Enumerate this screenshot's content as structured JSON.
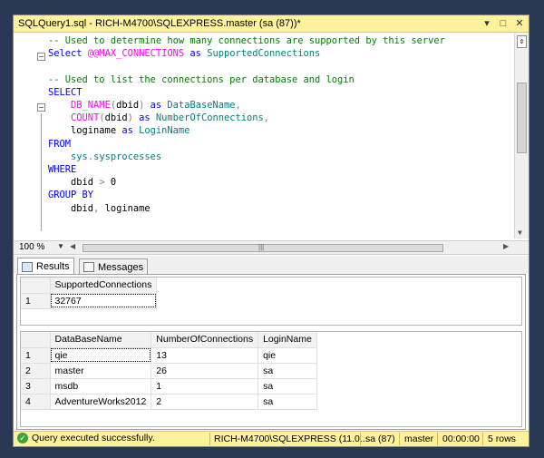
{
  "window": {
    "title": "SQLQuery1.sql - RICH-M4700\\SQLEXPRESS.master (sa (87))*",
    "controls": [
      "▾",
      "□",
      "✕"
    ]
  },
  "editor": {
    "lines": [
      {
        "parts": [
          {
            "t": "-- Used to determine how many connections are supported by this server",
            "c": "cm"
          }
        ]
      },
      {
        "parts": [
          {
            "t": "Select ",
            "c": "kw"
          },
          {
            "t": "@@MAX_CONNECTIONS",
            "c": "fn"
          },
          {
            "t": " as ",
            "c": "kw"
          },
          {
            "t": "SupportedConnections",
            "c": "tx"
          }
        ]
      },
      {
        "parts": []
      },
      {
        "parts": [
          {
            "t": "-- Used to list the connections per database and login",
            "c": "cm"
          }
        ]
      },
      {
        "parts": [
          {
            "t": "SELECT",
            "c": "kw"
          }
        ]
      },
      {
        "parts": [
          {
            "t": "    ",
            "c": "id"
          },
          {
            "t": "DB_NAME",
            "c": "fn"
          },
          {
            "t": "(",
            "c": "op"
          },
          {
            "t": "dbid",
            "c": "id"
          },
          {
            "t": ")",
            "c": "op"
          },
          {
            "t": " as ",
            "c": "kw"
          },
          {
            "t": "DataBaseName",
            "c": "tx"
          },
          {
            "t": ",",
            "c": "op"
          }
        ]
      },
      {
        "parts": [
          {
            "t": "    ",
            "c": "id"
          },
          {
            "t": "COUNT",
            "c": "fn"
          },
          {
            "t": "(",
            "c": "op"
          },
          {
            "t": "dbid",
            "c": "id"
          },
          {
            "t": ")",
            "c": "op"
          },
          {
            "t": " as ",
            "c": "kw"
          },
          {
            "t": "NumberOfConnections",
            "c": "tx"
          },
          {
            "t": ",",
            "c": "op"
          }
        ]
      },
      {
        "parts": [
          {
            "t": "    loginame",
            "c": "id"
          },
          {
            "t": " as ",
            "c": "kw"
          },
          {
            "t": "LoginName",
            "c": "tx"
          }
        ]
      },
      {
        "parts": [
          {
            "t": "FROM",
            "c": "kw"
          }
        ]
      },
      {
        "parts": [
          {
            "t": "    sys",
            "c": "tx"
          },
          {
            "t": ".",
            "c": "op"
          },
          {
            "t": "sysprocesses",
            "c": "tx"
          }
        ]
      },
      {
        "parts": [
          {
            "t": "WHERE",
            "c": "kw"
          }
        ]
      },
      {
        "parts": [
          {
            "t": "    dbid ",
            "c": "id"
          },
          {
            "t": ">",
            "c": "op"
          },
          {
            "t": " 0",
            "c": "id"
          }
        ]
      },
      {
        "parts": [
          {
            "t": "GROUP BY",
            "c": "kw"
          }
        ]
      },
      {
        "parts": [
          {
            "t": "    dbid",
            "c": "id"
          },
          {
            "t": ",",
            "c": "op"
          },
          {
            "t": " loginame",
            "c": "id"
          }
        ]
      }
    ]
  },
  "zoom": {
    "value": "100 %"
  },
  "tabs": [
    {
      "label": "Results",
      "active": true
    },
    {
      "label": "Messages",
      "active": false
    }
  ],
  "result1": {
    "columns": [
      "SupportedConnections"
    ],
    "rows": [
      {
        "n": "1",
        "cells": [
          "32767"
        ]
      }
    ]
  },
  "result2": {
    "columns": [
      "DataBaseName",
      "NumberOfConnections",
      "LoginName"
    ],
    "rows": [
      {
        "n": "1",
        "cells": [
          "qie",
          "13",
          "qie"
        ]
      },
      {
        "n": "2",
        "cells": [
          "master",
          "26",
          "sa"
        ]
      },
      {
        "n": "3",
        "cells": [
          "msdb",
          "1",
          "sa"
        ]
      },
      {
        "n": "4",
        "cells": [
          "AdventureWorks2012",
          "2",
          "sa"
        ]
      }
    ]
  },
  "status": {
    "message": "Query executed successfully.",
    "server": "RICH-M4700\\SQLEXPRESS (11.0...",
    "user": "sa (87)",
    "database": "master",
    "elapsed": "00:00:00",
    "rows": "5 rows"
  },
  "colors": {
    "title_bg": "#fff29d",
    "keyword": "#0000ff",
    "comment": "#008000",
    "function": "#ff00ff",
    "identifier": "#008080",
    "success": "#3aa53a"
  }
}
